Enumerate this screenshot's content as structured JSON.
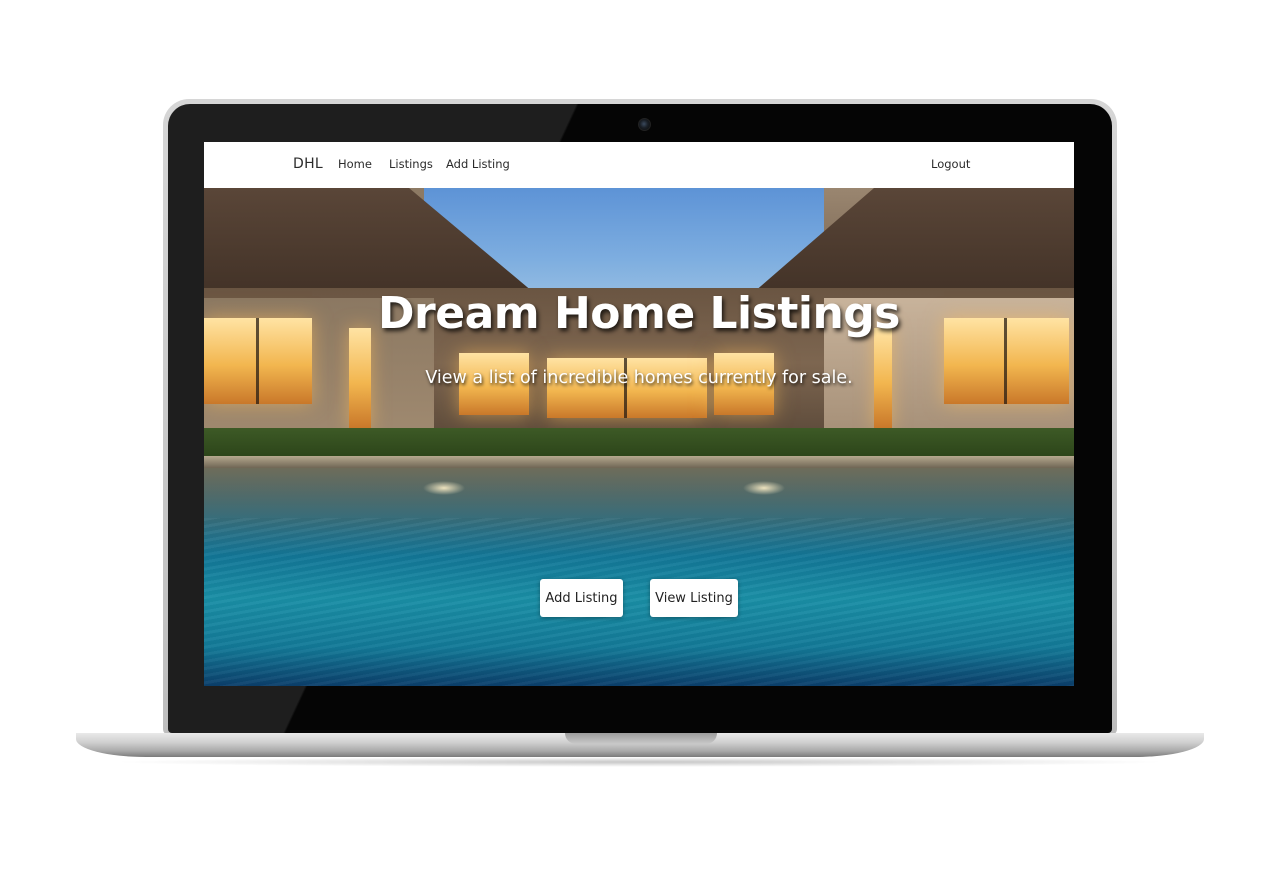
{
  "navbar": {
    "brand": "DHL",
    "links": [
      {
        "label": "Home"
      },
      {
        "label": "Listings"
      },
      {
        "label": "Add Listing"
      }
    ],
    "logout": "Logout"
  },
  "hero": {
    "title": "Dream Home Listings",
    "subtitle": "View a list of incredible homes currently for sale.",
    "buttons": [
      {
        "label": "Add Listing"
      },
      {
        "label": "View Listing"
      }
    ]
  }
}
